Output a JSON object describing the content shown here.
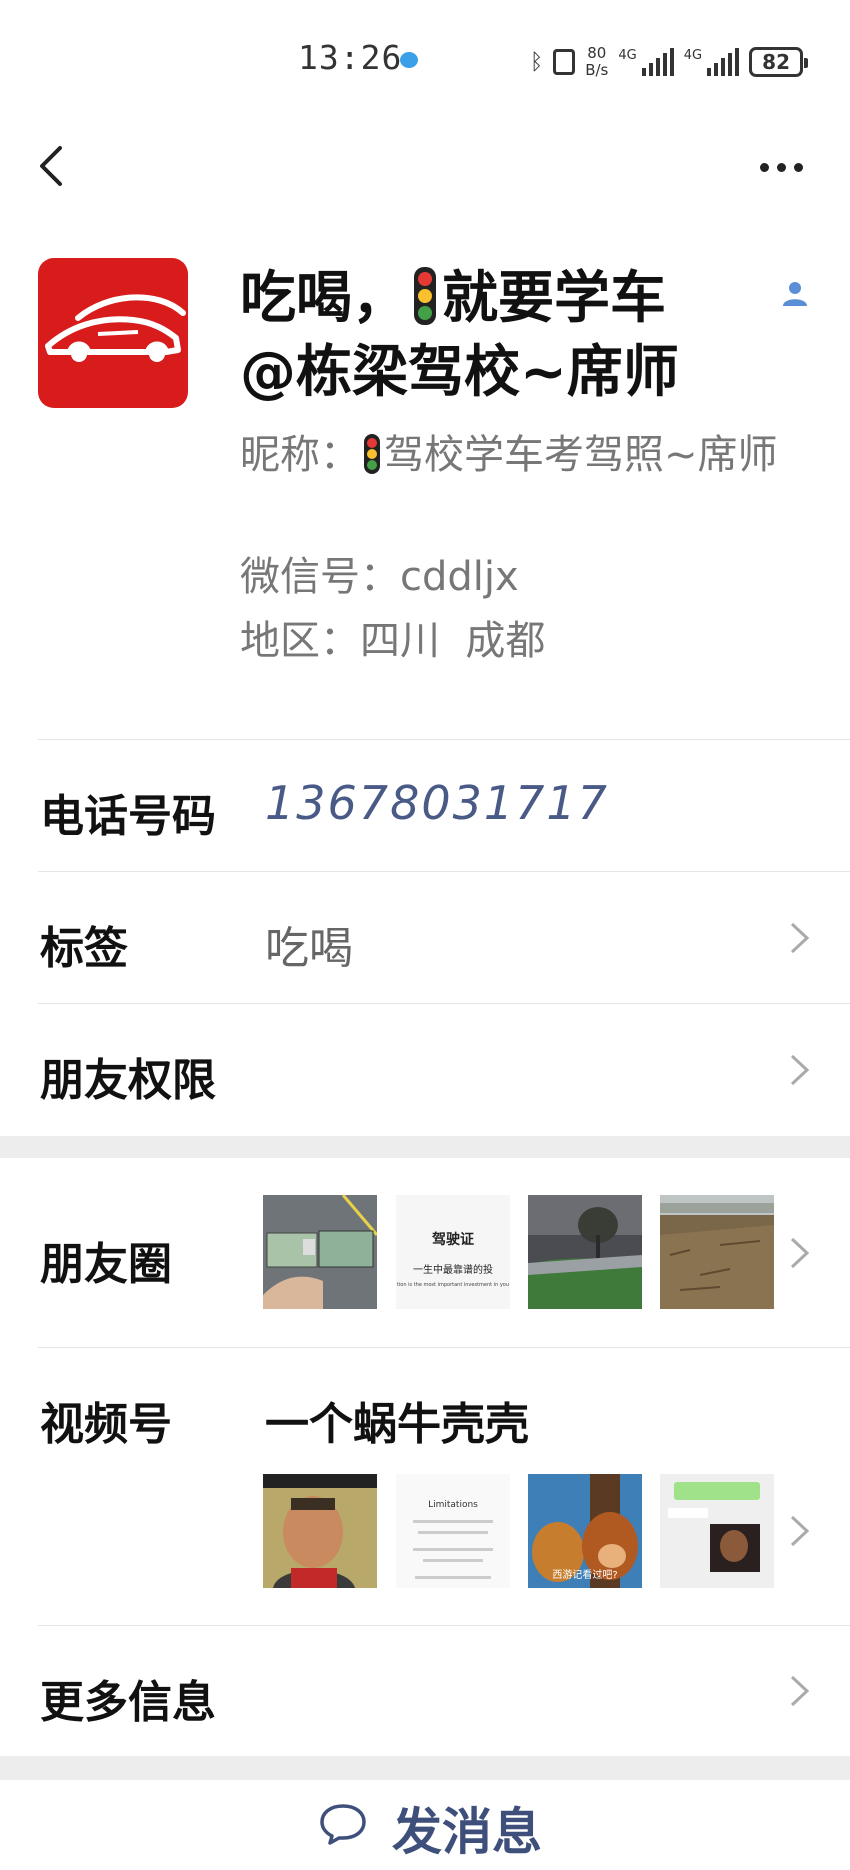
{
  "status_bar": {
    "time": "13:26",
    "net_speed_value": "80",
    "net_speed_unit": "B/s",
    "signal1_label": "4G",
    "signal2_label": "4G",
    "battery": "82"
  },
  "profile": {
    "title_part1": "吃喝，",
    "title_part2": "就要学车",
    "title_line2": "@栋梁驾校~席师",
    "nickname_prefix": "昵称：",
    "nickname_text": "驾校学车考驾照~席师",
    "wechat_id_label": "微信号：",
    "wechat_id": "cddljx",
    "region_label": "地区：",
    "region": "四川  成都"
  },
  "rows": {
    "phone_label": "电话号码",
    "phone_value": "13678031717",
    "tag_label": "标签",
    "tag_value": "吃喝",
    "permission_label": "朋友权限",
    "moments_label": "朋友圈",
    "channels_label": "视频号",
    "channels_value": "一个蜗牛壳壳",
    "more_info_label": "更多信息"
  },
  "moments_thumbs": {
    "t2_title": "驾驶证",
    "t2_line1": "一生中最靠谱的投",
    "t2_line2": "tion is the most important investment in you"
  },
  "channel_thumbs": {
    "t2_title": "Limitations",
    "t3_caption": "西游记看过吧?"
  },
  "actions": {
    "send_message": "发消息"
  },
  "colors": {
    "avatar_bg": "#d81c1c",
    "phone_value": "#4a5a86",
    "send_text": "#3d4f7a",
    "section_gap": "#ededed"
  }
}
